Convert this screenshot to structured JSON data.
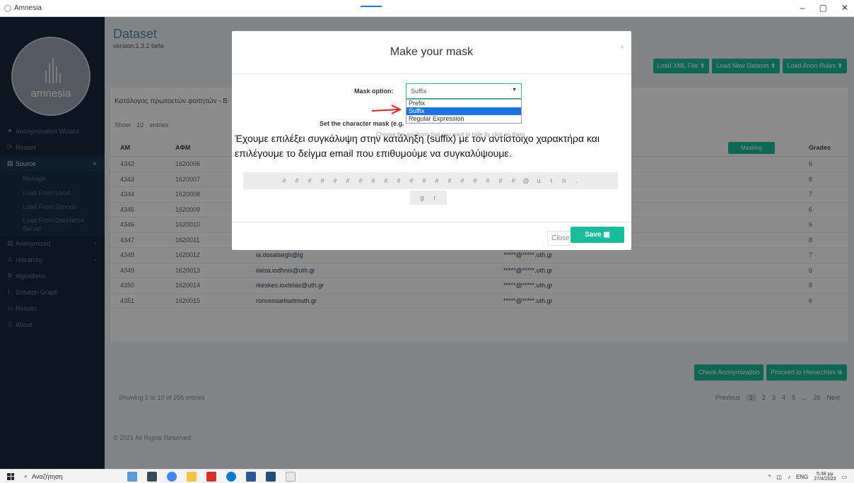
{
  "window": {
    "title": "Amnesia",
    "controls": [
      "–",
      "▢",
      "✕"
    ]
  },
  "sidebar": {
    "logo_text": "amnesia",
    "items": [
      {
        "label": "Anonymization Wizard",
        "icon": "wizard-icon",
        "glyph": "★"
      },
      {
        "label": "Restart",
        "icon": "restart-icon",
        "glyph": "⟳"
      },
      {
        "label": "Source",
        "icon": "source-icon",
        "glyph": "▤",
        "active": true,
        "chevron": "v"
      },
      {
        "label": "Anonymized",
        "icon": "anonymized-icon",
        "glyph": "▤",
        "chevron": "‹"
      },
      {
        "label": "Hierarchy",
        "icon": "hierarchy-icon",
        "glyph": "♙",
        "chevron": "‹"
      },
      {
        "label": "Algorithms",
        "icon": "algorithms-icon",
        "glyph": "⚙"
      },
      {
        "label": "Solution Graph",
        "icon": "graph-icon",
        "glyph": "⌇"
      },
      {
        "label": "Results",
        "icon": "results-icon",
        "glyph": "▭"
      },
      {
        "label": "About",
        "icon": "about-icon",
        "glyph": "◎"
      }
    ],
    "source_sub": [
      "Manage",
      "Load From Local",
      "Load From Zenodo",
      "Load From Dataverse Server"
    ]
  },
  "main": {
    "title": "Dataset",
    "version": "version:1.3.2 beta",
    "buttons": [
      "Load XML File ⬆",
      "Load New Dataset ⬆",
      "Load Anon Rules ⬆"
    ],
    "panel_title": "Κατάλογος πρωτοετών φοιτητών - Β",
    "show_prefix": "Show",
    "show_value": "10",
    "show_suffix": "entries",
    "columns": {
      "am": "AM",
      "agm": "AΦM",
      "masking": "Masking",
      "grades": "Grades"
    },
    "rows": [
      {
        "am": "4342",
        "agm": "1620006",
        "grade": "6"
      },
      {
        "am": "4343",
        "agm": "1620007",
        "grade": "8"
      },
      {
        "am": "4344",
        "agm": "1620008",
        "grade": "7"
      },
      {
        "am": "4345",
        "agm": "1620009",
        "grade": "6"
      },
      {
        "am": "4346",
        "agm": "1620010",
        "grade": "6"
      },
      {
        "am": "4347",
        "agm": "1620011",
        "grade": "8"
      },
      {
        "am": "4348",
        "agm": "1620012",
        "name": "ia.dosalsegh@ig",
        "email": "*****@*****.uth.gr",
        "grade": "7"
      },
      {
        "am": "4349",
        "agm": "1620013",
        "name": "ilaisa.iodhnis@uth.gr",
        "email": "*****@*****.uth.gr",
        "grade": "6"
      },
      {
        "am": "4350",
        "agm": "1620014",
        "name": "rkeskes.ioxtelas@uth.gr",
        "email": "*****@*****.uth.gr",
        "grade": "8"
      },
      {
        "am": "4351",
        "agm": "1620015",
        "name": "ronvessarlisetmuth.gr",
        "email": "*****@*****.uth.gr",
        "grade": "6"
      }
    ],
    "showing": "Showing 1 to 10 of 256 entries",
    "pager": [
      "Previous",
      "1",
      "2",
      "3",
      "4",
      "5",
      "...",
      "26",
      "Next"
    ],
    "action_buttons": [
      "Check Anonymization",
      "Proceed to Hierarchies ⊕"
    ],
    "footer": "© 2021 All Rights Reserved"
  },
  "modal": {
    "title": "Make your mask",
    "close_x": "×",
    "mask_option_label": "Mask option:",
    "mask_option_value": "Suffix",
    "options": [
      "Prefix",
      "Suffix",
      "Regular Expression"
    ],
    "selected_option": "Suffix",
    "set_char_label": "Set the character mask (e.g. *",
    "choose_hint": "Choose the positions that you want to hide by click on them",
    "annotation": "Έχουμε επιλέξει συγκάλυψη στην κατάληξη (suffix) με τον αντίστοιχο χαρακτήρα και επιλέγουμε το δείγμα email που επιθυμούμε να συγκαλύψουμε.",
    "chars_line1": [
      "#",
      "#",
      "#",
      "#",
      "#",
      "#",
      "#",
      "#",
      "#",
      "#",
      "#",
      "#",
      "#",
      "#",
      "#",
      "#",
      "#",
      "#",
      "#",
      "@",
      "u",
      "t",
      "h",
      "."
    ],
    "chars_line2": [
      "g",
      "r"
    ],
    "close_label": "Close",
    "save_label": "Save ▦"
  },
  "taskbar": {
    "search": "Αναζήτηση",
    "lang": "ENG",
    "time": "5:38 μμ",
    "date": "27/4/2023"
  }
}
